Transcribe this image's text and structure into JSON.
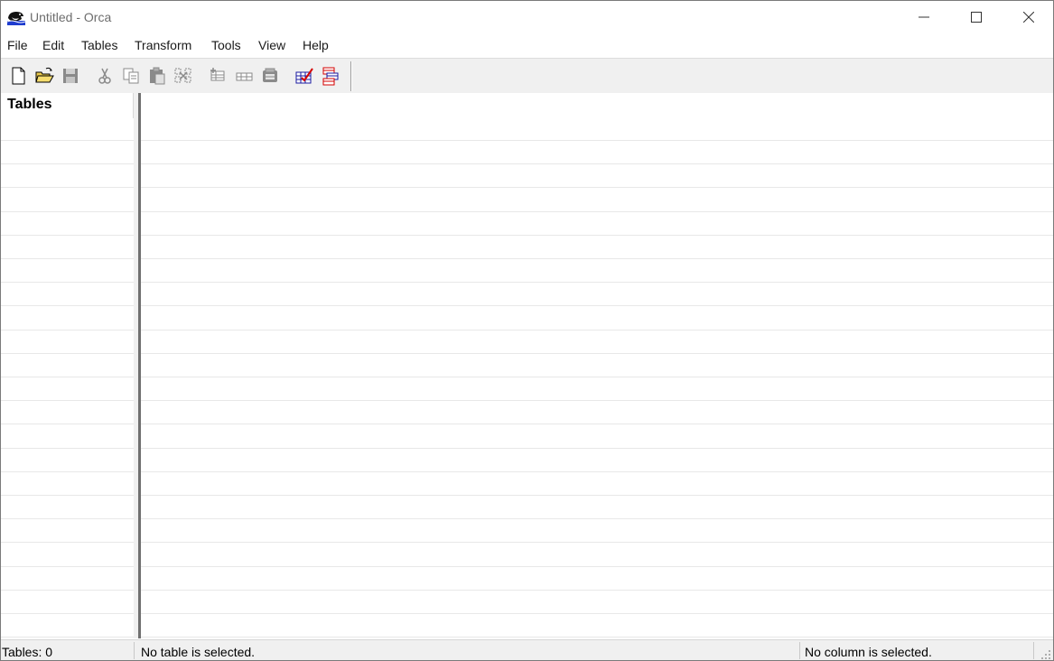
{
  "window": {
    "title": "Untitled - Orca",
    "app_icon": "orca-whale-icon",
    "controls": [
      "minimize-icon",
      "maximize-icon",
      "close-icon"
    ]
  },
  "menu": {
    "file": "File",
    "edit": "Edit",
    "tables": "Tables",
    "transform": "Transform",
    "tools": "Tools",
    "view": "View",
    "help": "Help"
  },
  "toolbar": {
    "buttons": [
      {
        "name": "new-icon"
      },
      {
        "name": "open-folder-icon"
      },
      {
        "name": "save-icon"
      },
      {
        "name": "cut-icon"
      },
      {
        "name": "copy-icon"
      },
      {
        "name": "paste-icon"
      },
      {
        "name": "delete-icon"
      },
      {
        "name": "add-table-icon"
      },
      {
        "name": "add-row-icon"
      },
      {
        "name": "export-table-icon"
      },
      {
        "name": "validate-icon"
      },
      {
        "name": "merge-module-icon"
      }
    ]
  },
  "left_pane": {
    "header": "Tables"
  },
  "status": {
    "tables_count": "Tables: 0",
    "table_status": "No table is selected.",
    "column_status": "No column is selected."
  },
  "colors": {
    "splitter": "#707070",
    "toolbar_bg": "#f0f0f0",
    "accent_red": "#d40000",
    "accent_blue": "#1a1aa0"
  }
}
